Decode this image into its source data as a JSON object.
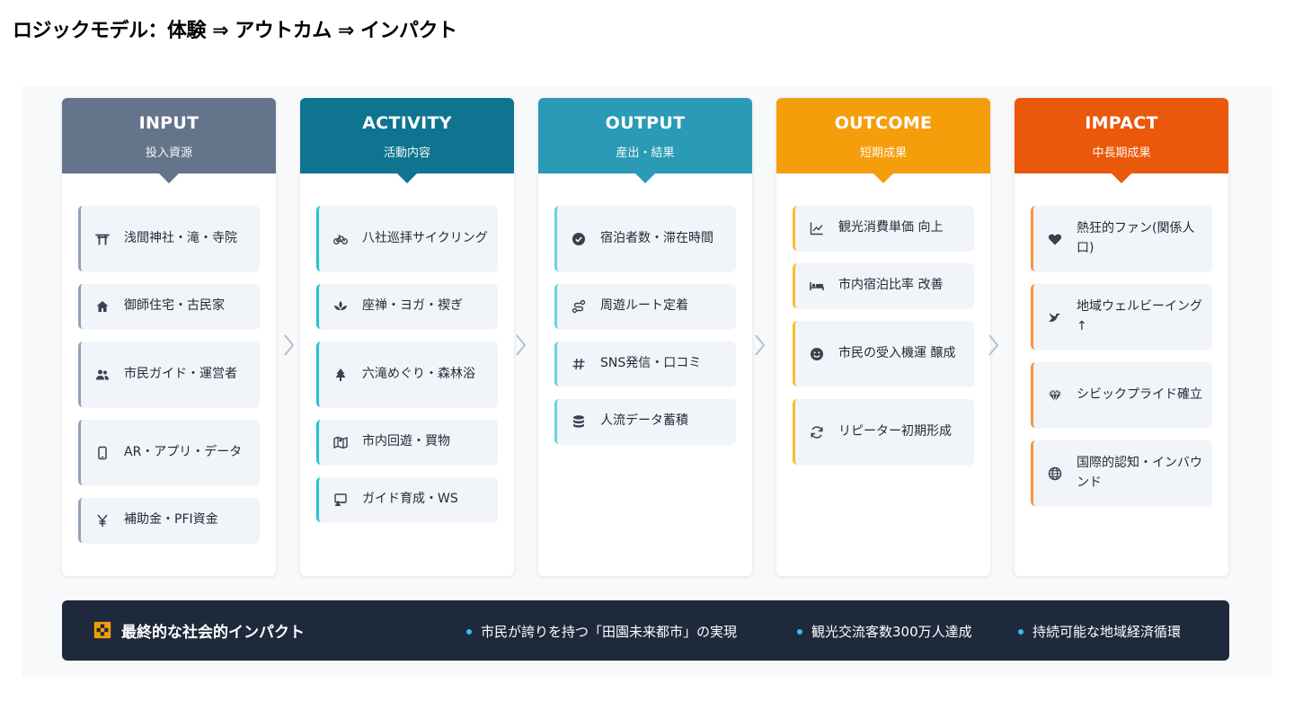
{
  "title": "ロジックモデル：体験 ⇒ アウトカム ⇒ インパクト",
  "columns": [
    {
      "title": "INPUT",
      "subtitle": "投入資源",
      "header_color": "#64748b",
      "accent_color": "#94a3b8",
      "items": [
        {
          "icon": "torii-icon",
          "label": "浅間神社・滝・寺院"
        },
        {
          "icon": "home-icon",
          "label": "御師住宅・古民家"
        },
        {
          "icon": "users-icon",
          "label": "市民ガイド・運営者"
        },
        {
          "icon": "phone-icon",
          "label": "AR・アプリ・データ"
        },
        {
          "icon": "yen-icon",
          "label": "補助金・PFI資金"
        }
      ]
    },
    {
      "title": "ACTIVITY",
      "subtitle": "活動内容",
      "header_color": "#0e7490",
      "accent_color": "#22c3cf",
      "items": [
        {
          "icon": "bicycle-icon",
          "label": "八社巡拝サイクリング"
        },
        {
          "icon": "lotus-icon",
          "label": "座禅・ヨガ・禊ぎ"
        },
        {
          "icon": "tree-icon",
          "label": "六滝めぐり・森林浴"
        },
        {
          "icon": "map-icon",
          "label": "市内回遊・買物"
        },
        {
          "icon": "presentation-icon",
          "label": "ガイド育成・WS"
        }
      ]
    },
    {
      "title": "OUTPUT",
      "subtitle": "産出・結果",
      "header_color": "#2a9ab5",
      "accent_color": "#67d3e0",
      "items": [
        {
          "icon": "check-circle-icon",
          "label": "宿泊者数・滞在時間"
        },
        {
          "icon": "route-icon",
          "label": "周遊ルート定着"
        },
        {
          "icon": "hashtag-icon",
          "label": "SNS発信・口コミ"
        },
        {
          "icon": "database-icon",
          "label": "人流データ蓄積"
        }
      ]
    },
    {
      "title": "OUTCOME",
      "subtitle": "短期成果",
      "header_color": "#f59e0b",
      "accent_color": "#fbbf24",
      "items": [
        {
          "icon": "chart-line-icon",
          "label": "観光消費単価 向上"
        },
        {
          "icon": "bed-icon",
          "label": "市内宿泊比率 改善"
        },
        {
          "icon": "smile-icon",
          "label": "市民の受入機運 醸成"
        },
        {
          "icon": "refresh-icon",
          "label": "リピーター初期形成"
        }
      ]
    },
    {
      "title": "IMPACT",
      "subtitle": "中長期成果",
      "header_color": "#ea580c",
      "accent_color": "#fb923c",
      "items": [
        {
          "icon": "heart-icon",
          "label": "熱狂的ファン(関係人口)"
        },
        {
          "icon": "dove-icon",
          "label": "地域ウェルビーイング↑"
        },
        {
          "icon": "gem-icon",
          "label": "シビックプライド確立"
        },
        {
          "icon": "globe-icon",
          "label": "国際的認知・インバウンド"
        }
      ]
    }
  ],
  "bottom": {
    "icon": "flag-icon",
    "title": "最終的な社会的インパクト",
    "points": [
      "市民が誇りを持つ「田園未来都市」の実現",
      "観光交流客数300万人達成",
      "持続可能な地域経済循環"
    ]
  }
}
